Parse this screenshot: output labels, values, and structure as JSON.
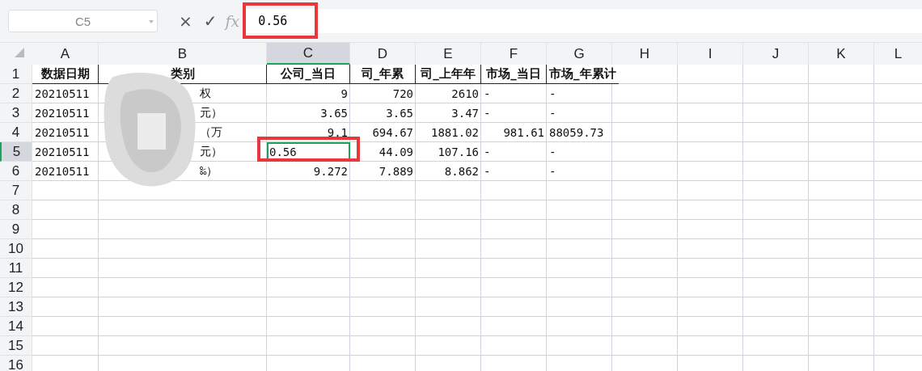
{
  "formula_bar": {
    "name_box": "C5",
    "cancel": "×",
    "confirm": "✓",
    "fx": "fx",
    "value": "0.56"
  },
  "columns": [
    {
      "label": "A",
      "selected": false
    },
    {
      "label": "B",
      "selected": false
    },
    {
      "label": "C",
      "selected": true
    },
    {
      "label": "D",
      "selected": false
    },
    {
      "label": "E",
      "selected": false
    },
    {
      "label": "F",
      "selected": false
    },
    {
      "label": "G",
      "selected": false
    },
    {
      "label": "H",
      "selected": false
    },
    {
      "label": "I",
      "selected": false
    },
    {
      "label": "J",
      "selected": false
    },
    {
      "label": "K",
      "selected": false
    },
    {
      "label": "L",
      "selected": false
    }
  ],
  "rows": [
    {
      "number": "1",
      "selected": false,
      "cells": [
        {
          "text": "数据日期",
          "kind": "header",
          "selected": false
        },
        {
          "text": "类别",
          "kind": "header",
          "selected": false
        },
        {
          "text": "公司_当日",
          "kind": "header",
          "selected": false
        },
        {
          "text": "司_年累",
          "kind": "header",
          "selected": false
        },
        {
          "text": "司_上年年",
          "kind": "header",
          "selected": false
        },
        {
          "text": "市场_当日",
          "kind": "header",
          "selected": false
        },
        {
          "text": "市场_年累计",
          "kind": "header",
          "selected": false
        }
      ]
    },
    {
      "number": "2",
      "selected": false,
      "cells": [
        {
          "text": "20210511",
          "kind": "text",
          "selected": false
        },
        {
          "text": "权",
          "kind": "text",
          "selected": false
        },
        {
          "text": "9",
          "kind": "number",
          "selected": false
        },
        {
          "text": "720",
          "kind": "number",
          "selected": false
        },
        {
          "text": "2610",
          "kind": "number",
          "selected": false
        },
        {
          "text": "-",
          "kind": "text",
          "selected": false
        },
        {
          "text": "-",
          "kind": "text",
          "selected": false
        }
      ]
    },
    {
      "number": "3",
      "selected": false,
      "cells": [
        {
          "text": "20210511",
          "kind": "text",
          "selected": false
        },
        {
          "text": "元）",
          "kind": "text",
          "selected": false
        },
        {
          "text": "3.65",
          "kind": "number",
          "selected": false
        },
        {
          "text": "3.65",
          "kind": "number",
          "selected": false
        },
        {
          "text": "3.47",
          "kind": "number",
          "selected": false
        },
        {
          "text": "-",
          "kind": "text",
          "selected": false
        },
        {
          "text": "-",
          "kind": "text",
          "selected": false
        }
      ]
    },
    {
      "number": "4",
      "selected": false,
      "cells": [
        {
          "text": "20210511",
          "kind": "text",
          "selected": false
        },
        {
          "text": "（万",
          "kind": "text",
          "selected": false
        },
        {
          "text": "9.1",
          "kind": "number",
          "selected": false
        },
        {
          "text": "694.67",
          "kind": "number",
          "selected": false
        },
        {
          "text": "1881.02",
          "kind": "number",
          "selected": false
        },
        {
          "text": "981.61",
          "kind": "number",
          "selected": false
        },
        {
          "text": "88059.73",
          "kind": "text",
          "selected": false
        }
      ]
    },
    {
      "number": "5",
      "selected": true,
      "cells": [
        {
          "text": "20210511",
          "kind": "text",
          "selected": false
        },
        {
          "text": "元）",
          "kind": "text",
          "selected": false
        },
        {
          "text": "0.56",
          "kind": "text",
          "selected": true
        },
        {
          "text": "44.09",
          "kind": "number",
          "selected": false
        },
        {
          "text": "107.16",
          "kind": "number",
          "selected": false
        },
        {
          "text": "-",
          "kind": "text",
          "selected": false
        },
        {
          "text": "-",
          "kind": "text",
          "selected": false
        }
      ]
    },
    {
      "number": "6",
      "selected": false,
      "cells": [
        {
          "text": "20210511",
          "kind": "text",
          "selected": false
        },
        {
          "text": "‰）",
          "kind": "text",
          "selected": false
        },
        {
          "text": "9.272",
          "kind": "number",
          "selected": false
        },
        {
          "text": "7.889",
          "kind": "number",
          "selected": false
        },
        {
          "text": "8.862",
          "kind": "number",
          "selected": false
        },
        {
          "text": "-",
          "kind": "text",
          "selected": false
        },
        {
          "text": "-",
          "kind": "text",
          "selected": false
        }
      ]
    },
    {
      "number": "7",
      "selected": false
    },
    {
      "number": "8",
      "selected": false
    },
    {
      "number": "9",
      "selected": false
    },
    {
      "number": "10",
      "selected": false
    },
    {
      "number": "11",
      "selected": false
    },
    {
      "number": "12",
      "selected": false
    },
    {
      "number": "13",
      "selected": false
    },
    {
      "number": "14",
      "selected": false
    },
    {
      "number": "15",
      "selected": false
    },
    {
      "number": "16",
      "selected": false
    }
  ]
}
